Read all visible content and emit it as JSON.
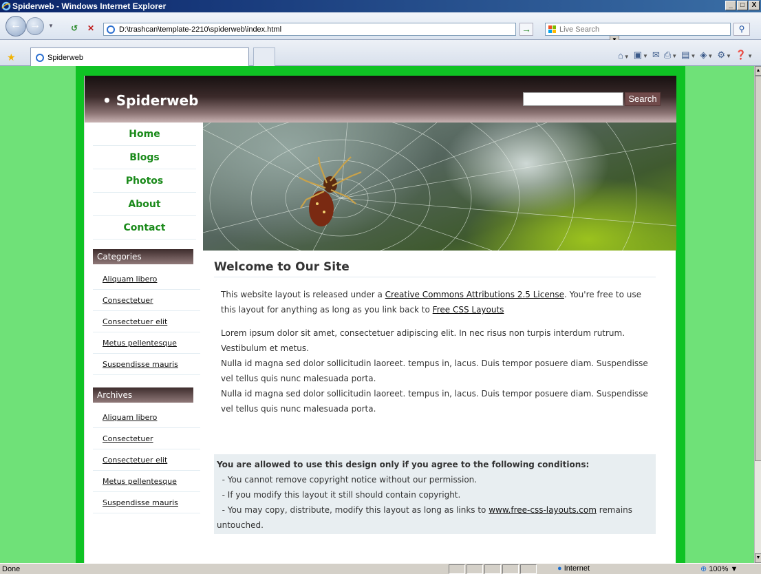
{
  "window": {
    "title": "Spiderweb - Windows Internet Explorer",
    "buttons": [
      "_",
      "□",
      "X"
    ]
  },
  "toolbar": {
    "address": "D:\\trashcan\\template-2210\\spiderweb\\index.html",
    "search_placeholder": "Live Search"
  },
  "tab": {
    "label": "Spiderweb"
  },
  "site": {
    "logo": "• Spiderweb",
    "search_button": "Search",
    "nav": [
      "Home",
      "Blogs",
      "Photos",
      "About",
      "Contact"
    ],
    "categories": {
      "heading": "Categories",
      "items": [
        "Aliquam libero",
        "Consectetuer",
        "Consectetuer elit",
        "Metus pellentesque",
        "Suspendisse mauris"
      ]
    },
    "archives": {
      "heading": "Archives",
      "items": [
        "Aliquam libero",
        "Consectetuer",
        "Consectetuer elit",
        "Metus pellentesque",
        "Suspendisse mauris"
      ]
    },
    "welcome": {
      "title": "Welcome to Our Site",
      "p1_before": "This website layout is released under a ",
      "p1_link1": "Creative Commons Attributions 2.5 License",
      "p1_middle": ". You're free to use this layout for anything as long as you link back to ",
      "p1_link2": "Free CSS Layouts",
      "p2_lines": [
        "Lorem ipsum dolor sit amet, consectetuer adipiscing elit. In nec risus non turpis interdum rutrum. Vestibulum et metus.",
        "Nulla id magna sed dolor sollicitudin laoreet. tempus in, lacus. Duis tempor posuere diam. Suspendisse vel tellus quis nunc malesuada porta.",
        "Nulla id magna sed dolor sollicitudin laoreet. tempus in, lacus. Duis tempor posuere diam. Suspendisse vel tellus quis nunc malesuada porta."
      ]
    },
    "conditions": {
      "title": "You are allowed to use this design only if you agree to the following conditions:",
      "line1": "  - You cannot remove copyright notice without our permission.",
      "line2": "  - If you modify this layout it still should contain copyright.",
      "line3_before": "  - You may copy, distribute, modify this layout as long as links to ",
      "line3_link": "www.free-css-layouts.com",
      "line3_after": " remains untouched."
    }
  },
  "status": {
    "text": "Done",
    "zone": "Internet",
    "zoom": "100%"
  },
  "colors": {
    "page_bg": "#6fe178",
    "frame": "#0fc224",
    "nav_link": "#1a8a1a",
    "header_dark": "#171111"
  }
}
